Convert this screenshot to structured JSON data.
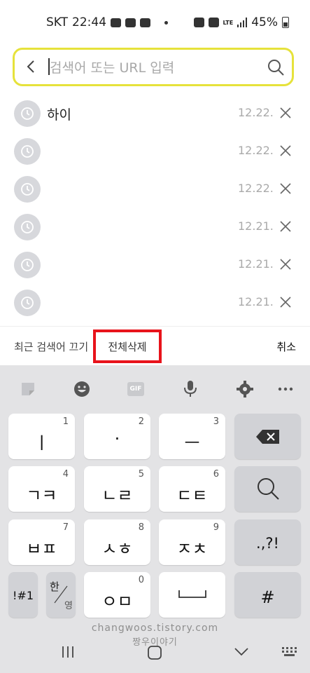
{
  "status": {
    "carrier": "SKT",
    "time": "22:44",
    "lte": "LTE",
    "battery": "45%"
  },
  "search": {
    "placeholder": "검색어 또는 URL 입력",
    "value": ""
  },
  "history": [
    {
      "text": "하이",
      "date": "12.22."
    },
    {
      "text": "",
      "date": "12.22."
    },
    {
      "text": "",
      "date": "12.22."
    },
    {
      "text": "",
      "date": "12.21."
    },
    {
      "text": "",
      "date": "12.21."
    },
    {
      "text": "",
      "date": "12.21."
    }
  ],
  "actions": {
    "toggle_recent": "최근 검색어 끄기",
    "delete_all": "전체삭제",
    "cancel": "취소"
  },
  "keyboard": {
    "toolbar": [
      "sticker-icon",
      "emoji-icon",
      "gif-icon",
      "mic-icon",
      "settings-icon",
      "more-icon"
    ],
    "gif": "GIF",
    "keys": {
      "k1": "ㅣ",
      "k1n": "1",
      "k2": "·",
      "k2n": "2",
      "k3": "ㅡ",
      "k3n": "3",
      "k4": "ㄱㅋ",
      "k4n": "4",
      "k5": "ㄴㄹ",
      "k5n": "5",
      "k6": "ㄷㅌ",
      "k6n": "6",
      "k7": "ㅂㅍ",
      "k7n": "7",
      "k8": "ㅅㅎ",
      "k8n": "8",
      "k9": "ㅈㅊ",
      "k9n": "9",
      "k0": "ㅇㅁ",
      "k0n": "0",
      "punct": ".,?!",
      "symbols": "!#1",
      "lang_top": "한",
      "lang_bottom": "영",
      "hash": "#"
    }
  },
  "watermark": {
    "line1": "changwoos.tistory.com",
    "line2": "짱우이야기"
  }
}
